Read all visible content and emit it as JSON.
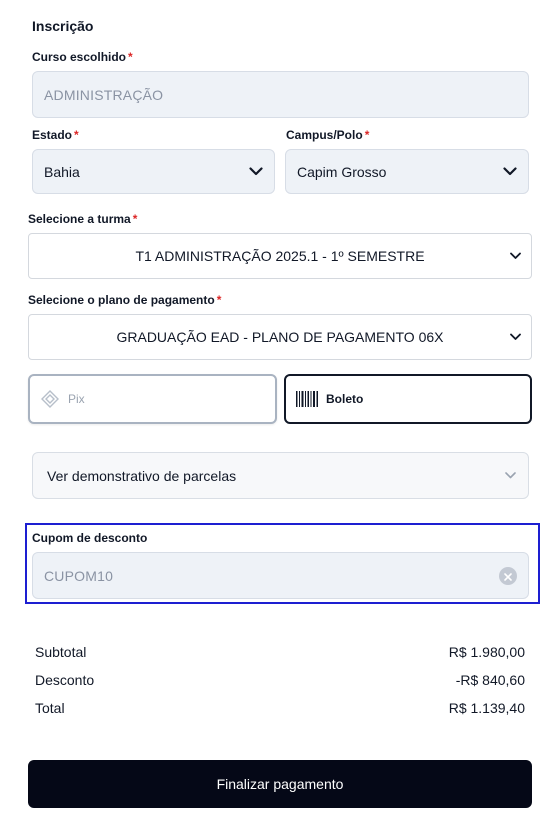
{
  "form": {
    "title": "Inscrição",
    "required_mark": "*",
    "course": {
      "label": "Curso escolhido",
      "value": "ADMINISTRAÇÃO"
    },
    "state": {
      "label": "Estado",
      "value": "Bahia"
    },
    "campus": {
      "label": "Campus/Polo",
      "value": "Capim Grosso"
    },
    "class": {
      "label": "Selecione a turma",
      "value": "T1 ADMINISTRAÇÃO 2025.1 - 1º SEMESTRE"
    },
    "plan": {
      "label": "Selecione o plano de pagamento",
      "value": "GRADUAÇÃO EAD - PLANO DE PAGAMENTO 06X"
    },
    "payment_methods": [
      {
        "label": "Pix",
        "icon": "pix-icon",
        "selected": false
      },
      {
        "label": "Boleto",
        "icon": "barcode-icon",
        "selected": true
      }
    ],
    "installments": {
      "label": "Ver demonstrativo de parcelas"
    },
    "coupon": {
      "label": "Cupom de desconto",
      "value": "CUPOM10"
    }
  },
  "summary": [
    {
      "label": "Subtotal",
      "value": "R$ 1.980,00"
    },
    {
      "label": "Desconto",
      "value": "-R$ 840,60"
    },
    {
      "label": "Total",
      "value": "R$ 1.139,40"
    }
  ],
  "actions": {
    "finish_label": "Finalizar pagamento"
  },
  "colors": {
    "required": "#dc2626",
    "primary_button": "#050817",
    "focus_outline": "#1d1fd1",
    "field_bg": "#eef2f7"
  }
}
